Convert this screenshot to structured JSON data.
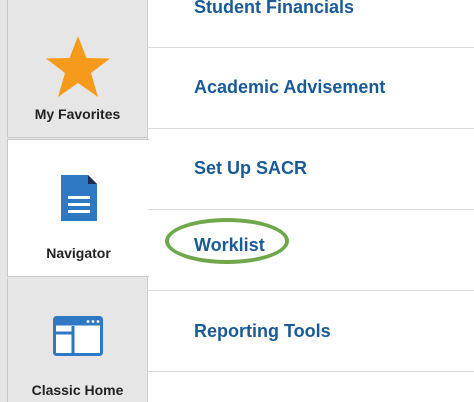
{
  "sidebar": {
    "items": [
      {
        "label": "My Favorites",
        "icon": "star-icon"
      },
      {
        "label": "Navigator",
        "icon": "document-icon"
      },
      {
        "label": "Classic Home",
        "icon": "window-icon"
      }
    ]
  },
  "menu": {
    "items": [
      {
        "label": "Student Financials"
      },
      {
        "label": "Academic Advisement"
      },
      {
        "label": "Set Up SACR"
      },
      {
        "label": "Worklist"
      },
      {
        "label": "Reporting Tools"
      }
    ]
  },
  "colors": {
    "link": "#1a5a96",
    "star": "#f59a1b",
    "document": "#2f78c4",
    "highlight": "#6fa84a"
  }
}
